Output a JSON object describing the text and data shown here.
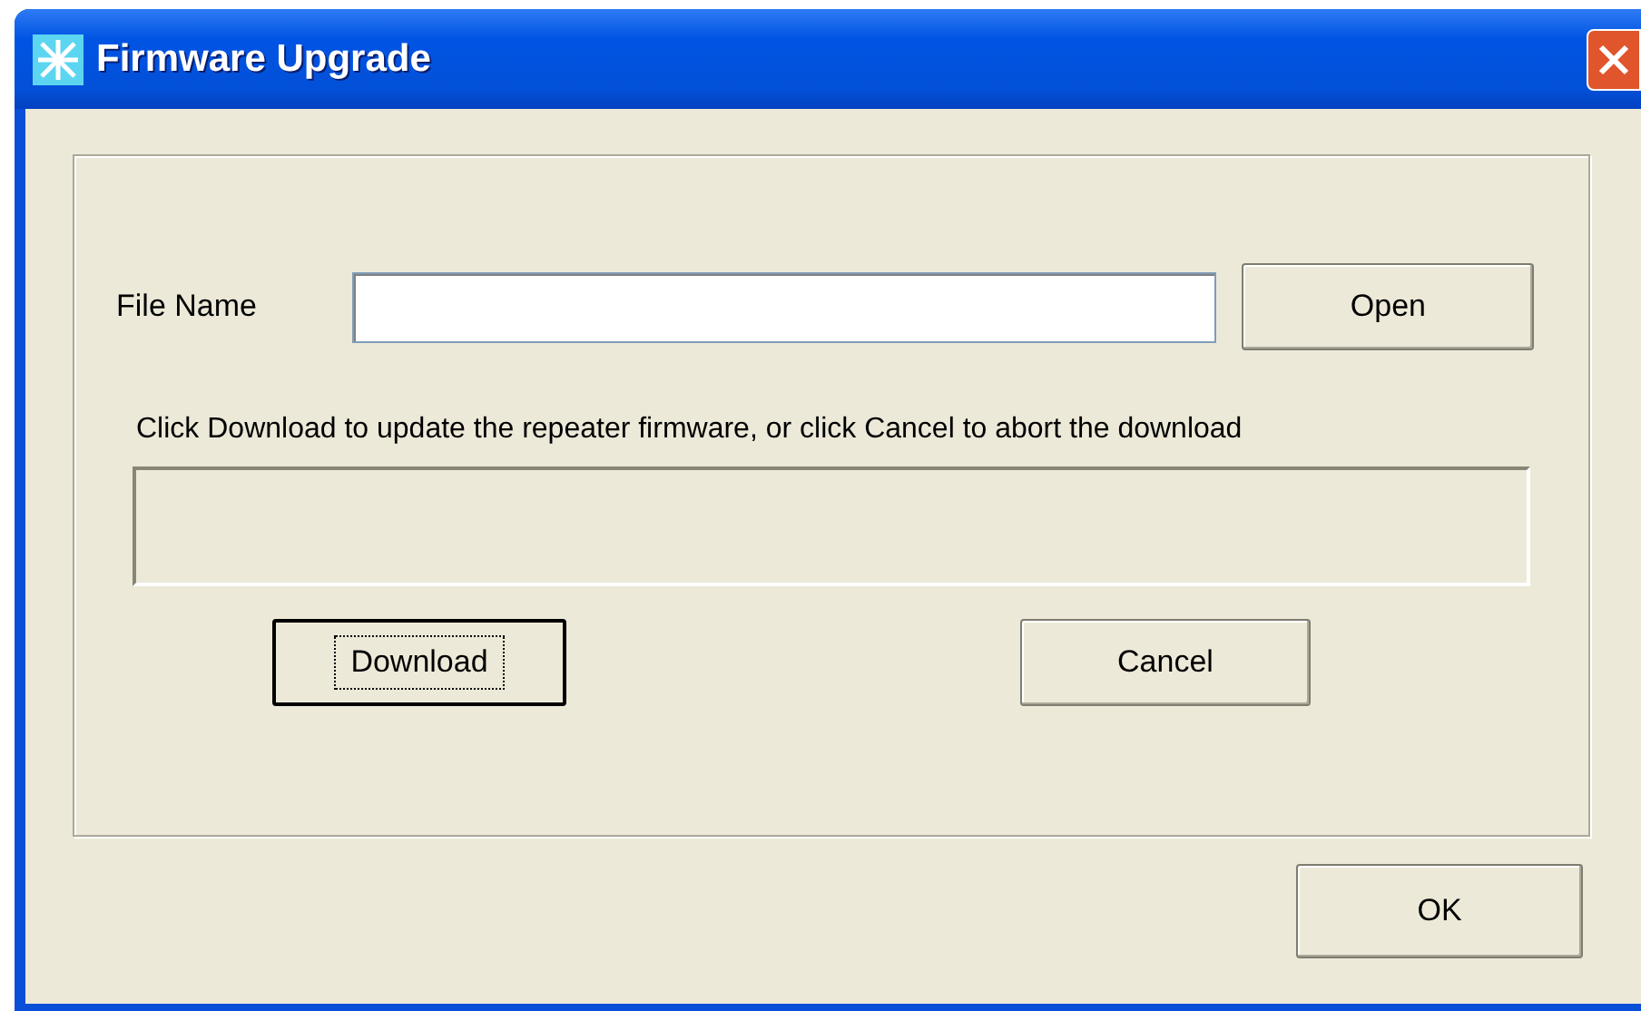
{
  "window": {
    "title": "Firmware Upgrade"
  },
  "file_name": {
    "label": "File Name"
  },
  "open_button": {
    "label": "Open",
    "focused": false
  },
  "instructions": "Click Download to update the repeater firmware, or click Cancel to abort the download",
  "actions": [
    {
      "label": "Download",
      "focused": true
    },
    {
      "label": "Cancel",
      "focused": false
    }
  ],
  "ok_button": {
    "label": "OK",
    "focused": false
  }
}
